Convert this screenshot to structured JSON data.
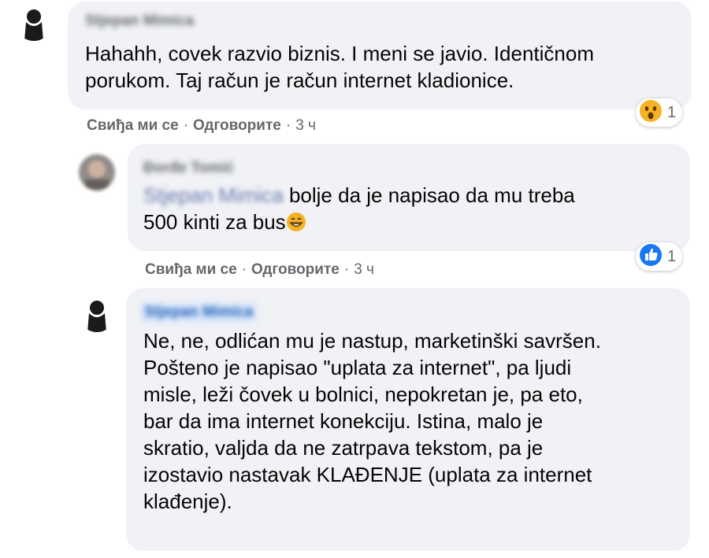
{
  "comments": [
    {
      "author": "Stjepan Mimica",
      "text": "Hahahh, covek razvio biznis. I meni se javio. Identičnom\nporukom. Taj račun je račun internet kladionice.",
      "actions": {
        "like": "Свиђа ми се",
        "reply": "Одговорите",
        "sep": "·",
        "time": "3 ч"
      },
      "reaction": {
        "icon": "wow-emoji-icon",
        "count": "1"
      }
    },
    {
      "author": "Đorđe Tomić",
      "mention": "Stjepan Mimica",
      "text_line1": " bolje da je napisao da mu treba",
      "text_line2": "500 kinti za bus",
      "emoji": "grinning-emoji-icon",
      "actions": {
        "like": "Свиђа ми се",
        "reply": "Одговорите",
        "sep": "·",
        "time": "3 ч"
      },
      "reaction": {
        "icon": "like-icon",
        "count": "1"
      }
    },
    {
      "author": "Stjepan Mimica",
      "text": "Ne, ne, odlićan mu je nastup, marketinški savršen.\nPošteno je napisao \"uplata za internet\", pa ljudi\nmisle, leži čovek u bolnici, nepokretan je, pa eto,\nbar da ima internet konekciju. Istina, malo je\nskratio, valjda da ne zatrpava tekstom, pa je\nizostavio nastavak KLAĐENJE (uplata za internet\nklađenje)."
    }
  ],
  "colors": {
    "bubble": "#f0f2f5",
    "secondary_text": "#65676b",
    "like_blue": "#1877f2",
    "wow_yellow": "#f7b125"
  }
}
